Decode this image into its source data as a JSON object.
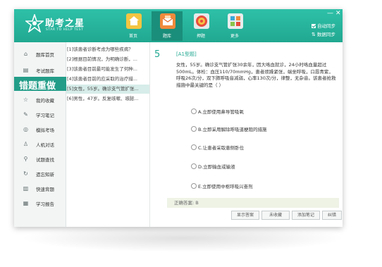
{
  "app": {
    "logo_name": "助考之星",
    "logo_sub": "STAR TO HELP TEST",
    "window_controls": [
      "—",
      "✕"
    ]
  },
  "nav": [
    {
      "label": "首页",
      "icon": "home-icon"
    },
    {
      "label": "题库",
      "icon": "question-bank-icon",
      "active": true
    },
    {
      "label": "押题",
      "icon": "target-icon"
    },
    {
      "label": "更多",
      "icon": "more-icon"
    }
  ],
  "sync": {
    "auto_sync": "自动同步",
    "data_sync": "数据同步"
  },
  "sidebar": {
    "items": [
      {
        "label": "题库首页",
        "icon": "home-icon"
      },
      {
        "label": "考试题库",
        "icon": "document-icon"
      },
      {
        "label": "我的收藏",
        "icon": "star-icon"
      },
      {
        "label": "学习笔记",
        "icon": "note-icon"
      },
      {
        "label": "模拟考场",
        "icon": "exam-icon"
      },
      {
        "label": "人机对话",
        "icon": "chat-icon"
      },
      {
        "label": "试题查找",
        "icon": "search-icon"
      },
      {
        "label": "遗忘知新",
        "icon": "refresh-icon"
      },
      {
        "label": "快速背题",
        "icon": "flash-icon"
      },
      {
        "label": "学习报告",
        "icon": "report-icon"
      }
    ],
    "active_label": "错题重做"
  },
  "question_list": [
    "[1]该患者诊断考虑为哪些疾病？",
    "[2]根据目前情况，为明确诊断，...",
    "[3]该患者目前最可能发生了何种...",
    "[4]该患者目前的应采取的治疗措...",
    "[5]女性，55岁。确诊支气管扩张...",
    "[6]男性，47岁。反复咳嗽、咳脓..."
  ],
  "question": {
    "number": "5",
    "type": "[A1型题]",
    "text": "女性，55岁。确诊支气管扩张30余年，因大咯血就诊，24小时咯血量超过500mL。体检：血压110/70mmHg，患者烦躁紧张，端坐呼吸，口唇青紫，呼吸26次/分，双下肺呼吸音减弱，心率130次/分，律整，无杂音。该患者抢救措施中最关键的是（  ）",
    "options": [
      "A.立即使用鼻导管吸氧",
      "B.立即采用解除呼吸道梗阻的措施",
      "C.让患者采取患侧卧位",
      "D.立即输血或输液",
      "E.立即使用中枢呼吸兴奋剂"
    ],
    "answer": "正确答案: B"
  },
  "actions": [
    "显示答案",
    "未收藏",
    "添加笔记",
    "纠错"
  ],
  "colors": {
    "brand": "#21a891",
    "active_sidebar": "#239d88",
    "selected_row": "#d7ede9"
  }
}
